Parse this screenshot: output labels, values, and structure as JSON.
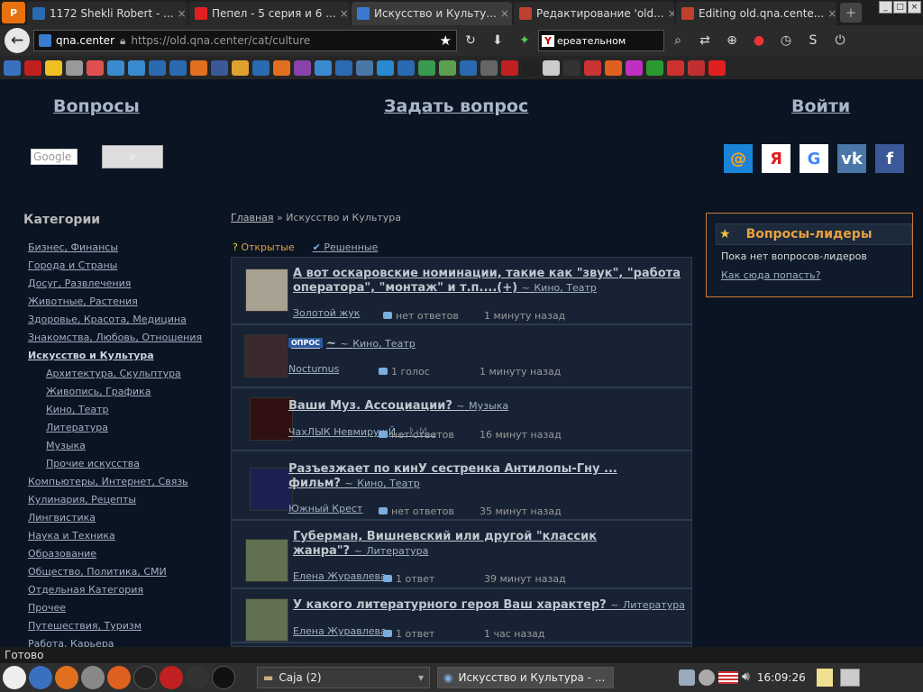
{
  "browser": {
    "menu_label": "P",
    "tabs": [
      {
        "title": "1172 Shekli Robert - ...",
        "fav": "#2a6ab0"
      },
      {
        "title": "Пепел - 5 серия и 6 ...",
        "fav": "#e02020"
      },
      {
        "title": "Искусство и Культу...",
        "fav": "#3a7ad0"
      },
      {
        "title": "Редактирование 'old...",
        "fav": "#c04030"
      },
      {
        "title": "Editing old.qna.cente...",
        "fav": "#c04030"
      }
    ],
    "new_tab": "+",
    "url_site": "qna.center",
    "url": "https://old.qna.center/cat/culture",
    "search_text": "ереательном"
  },
  "header": {
    "questions": "Вопросы",
    "ask": "Задать вопрос",
    "login": "Войти",
    "google_placeholder": "Google",
    "social": [
      {
        "name": "mail-ru",
        "glyph": "@",
        "bg": "#1a85d8",
        "fg": "#ffa21f"
      },
      {
        "name": "yandex",
        "glyph": "Я",
        "bg": "#ffffff",
        "fg": "#e02020"
      },
      {
        "name": "google",
        "glyph": "G",
        "bg": "#ffffff",
        "fg": "#4285f4"
      },
      {
        "name": "vk",
        "glyph": "vk",
        "bg": "#4a76a8",
        "fg": "#ffffff"
      },
      {
        "name": "facebook",
        "glyph": "f",
        "bg": "#3b5998",
        "fg": "#ffffff"
      }
    ]
  },
  "sidebar": {
    "title": "Категории",
    "items": [
      {
        "label": "Бизнес, Финансы",
        "sub": false
      },
      {
        "label": "Города и Страны",
        "sub": false
      },
      {
        "label": "Досуг, Развлечения",
        "sub": false
      },
      {
        "label": "Животные, Растения",
        "sub": false
      },
      {
        "label": "Здоровье, Красота, Медицина",
        "sub": false
      },
      {
        "label": "Знакомства, Любовь, Отношения",
        "sub": false
      },
      {
        "label": "Искусство и Культура",
        "sub": false,
        "current": true
      },
      {
        "label": "Архитектура, Скульптура",
        "sub": true
      },
      {
        "label": "Живопись, Графика",
        "sub": true
      },
      {
        "label": "Кино, Театр",
        "sub": true
      },
      {
        "label": "Литература",
        "sub": true
      },
      {
        "label": "Музыка",
        "sub": true
      },
      {
        "label": "Прочие искусства",
        "sub": true
      },
      {
        "label": "Компьютеры, Интернет, Связь",
        "sub": false
      },
      {
        "label": "Кулинария, Рецепты",
        "sub": false
      },
      {
        "label": "Лингвистика",
        "sub": false
      },
      {
        "label": "Наука и Техника",
        "sub": false
      },
      {
        "label": "Образование",
        "sub": false
      },
      {
        "label": "Общество, Политика, СМИ",
        "sub": false
      },
      {
        "label": "Отдельная Категория",
        "sub": false
      },
      {
        "label": "Прочее",
        "sub": false
      },
      {
        "label": "Путешествия, Туризм",
        "sub": false
      },
      {
        "label": "Работа, Карьера",
        "sub": false
      }
    ]
  },
  "breadcrumb": {
    "home": "Главная",
    "sep": "»",
    "current": "Искусство и Культура"
  },
  "filters": {
    "open": "Открытые",
    "solved": "Решенные"
  },
  "questions": [
    {
      "title": "А вот оскаровские номинации, такие как \"звук\", \"работа\nоператора\", \"монтаж\" и т.п....(+)",
      "category": "Кино, Театр",
      "author": "Золотой жук",
      "answers": "нет ответов",
      "time": "1 минуту назад",
      "thumb": "#a8a090"
    },
    {
      "title": "~",
      "poll": "ОПРОС",
      "category": "Кино, Театр",
      "author": "Nocturnus",
      "answers": "1 голос",
      "time": "1 минуту назад",
      "thumb": "#3a2a30"
    },
    {
      "title": "Ваши Муз. Ассоциации?",
      "category": "Музыка",
      "author": "ЧахЛЫК НевмирущЙ ...ᚱᚲᛞ...",
      "answers": "нет ответов",
      "time": "16 минут назад",
      "thumb": "#301010"
    },
    {
      "title": "Разъезжает по кинУ сестренка Антилопы-Гну ...\nфильм?",
      "category": "Кино, Театр",
      "author": "Южный Крест",
      "answers": "нет ответов",
      "time": "35 минут назад",
      "thumb": "#1a2050"
    },
    {
      "title": "Губерман, Вишневский или другой \"классик\nжанра\"?",
      "category": "Литература",
      "author": "Елена Журавлева",
      "answers": "1 ответ",
      "time": "39 минут назад",
      "thumb": "#607050"
    },
    {
      "title": "У какого литературного героя Ваш характер?",
      "category": "Литература",
      "author": "Елена Журавлева",
      "answers": "1 ответ",
      "time": "1 час назад",
      "thumb": "#607050"
    }
  ],
  "leaders": {
    "title": "Вопросы-лидеры",
    "empty": "Пока нет вопросов-лидеров",
    "how": "Как сюда попасть?"
  },
  "status": "Готово",
  "taskbar": {
    "folder": "Caja (2)",
    "browser": "Искусство и Культура - ...",
    "clock": "16:09:26"
  }
}
